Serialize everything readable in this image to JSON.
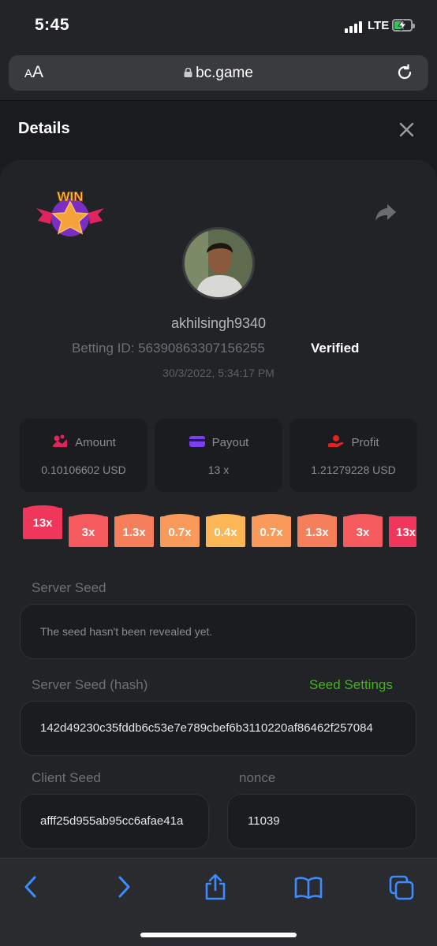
{
  "status_bar": {
    "time": "5:45",
    "network": "LTE"
  },
  "browser": {
    "text_size_label_small": "A",
    "text_size_label_large": "A",
    "domain": "bc.game"
  },
  "details": {
    "title": "Details",
    "username": "akhilsingh9340",
    "betting_id": "Betting ID: 56390863307156255",
    "verified": "Verified",
    "datetime": "30/3/2022, 5:34:17 PM",
    "stats": [
      {
        "label": "Amount",
        "value": "0.10106602 USD",
        "icon": "coins-icon",
        "color": "#e0245e"
      },
      {
        "label": "Payout",
        "value": "13 x",
        "icon": "card-icon",
        "color": "#7b3ff2"
      },
      {
        "label": "Profit",
        "value": "1.21279228 USD",
        "icon": "hand-coin-icon",
        "color": "#e02424"
      }
    ],
    "multipliers": [
      "13x",
      "3x",
      "1.3x",
      "0.7x",
      "0.4x",
      "0.7x",
      "1.3x",
      "3x",
      "13x"
    ],
    "multiplier_colors": [
      "#f0365a",
      "#f55b5e",
      "#f67f5b",
      "#f99a5a",
      "#fcb656",
      "#f99a5a",
      "#f67f5b",
      "#f55b5e",
      "#f0365a"
    ],
    "server_seed": {
      "label": "Server Seed",
      "value": "The seed hasn't been revealed yet."
    },
    "server_seed_hash": {
      "label": "Server Seed (hash)",
      "action": "Seed Settings",
      "value": "142d49230c35fddb6c53e7e789cbef6b3110220af86462f257084"
    },
    "client_seed": {
      "label": "Client Seed",
      "value": "afff25d955ab95cc6afae41a"
    },
    "nonce": {
      "label": "nonce",
      "value": "11039"
    }
  },
  "toolbar": [
    "back-icon",
    "forward-icon",
    "share-icon",
    "bookmarks-icon",
    "tabs-icon"
  ]
}
